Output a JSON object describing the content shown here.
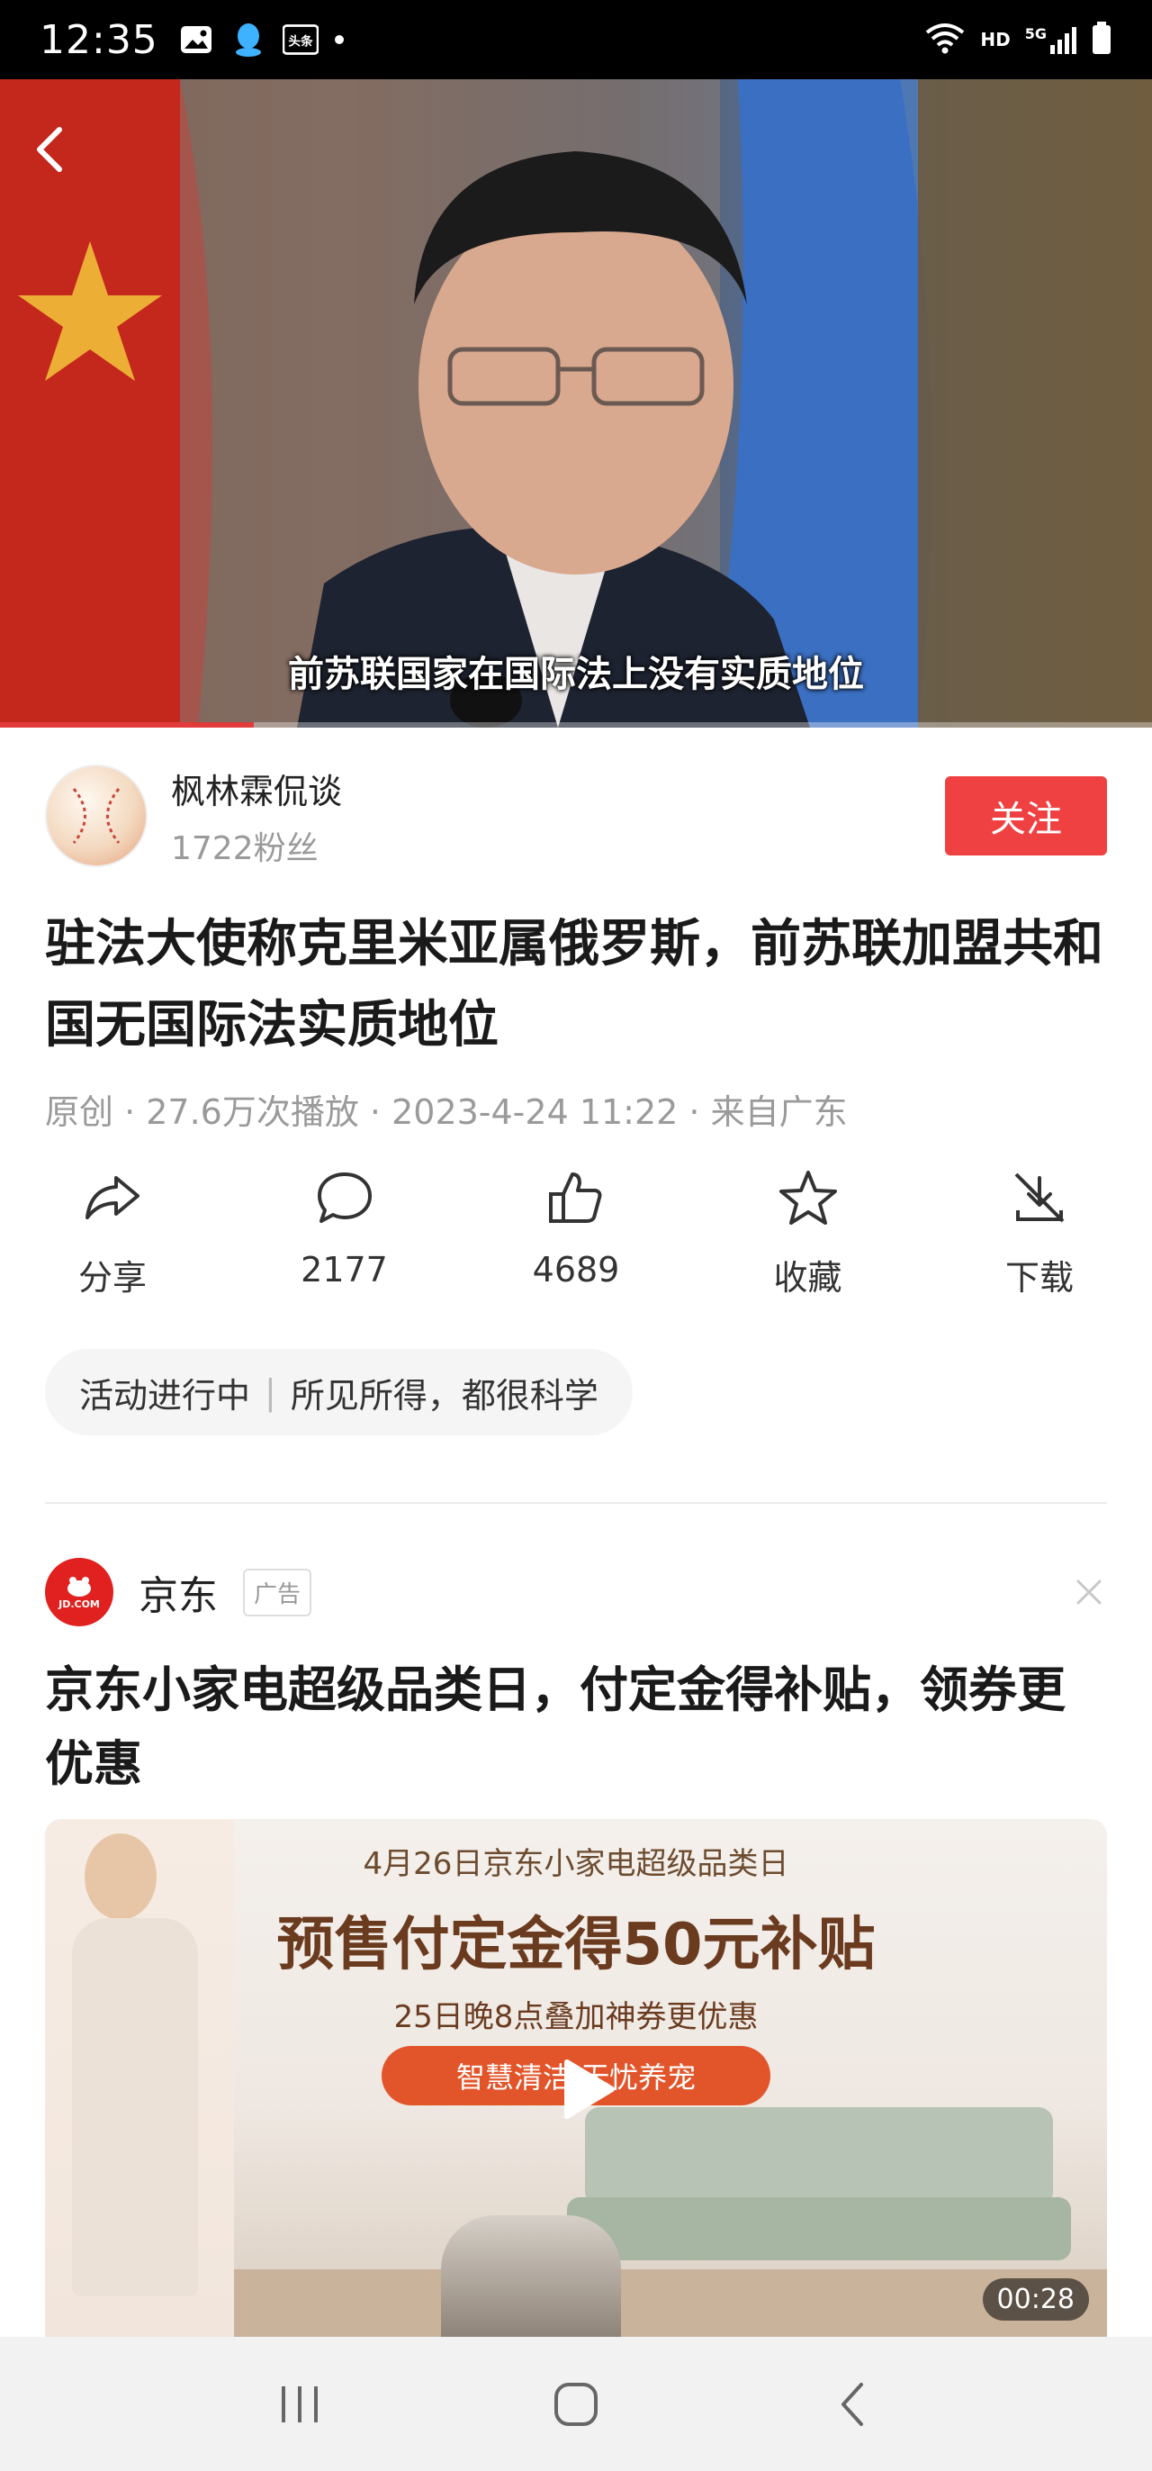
{
  "status_bar": {
    "time": "12:35",
    "left_icons": [
      "gallery-icon",
      "qq-icon",
      "toutiao-icon",
      "dot"
    ],
    "toutiao_label": "头条",
    "right_icons": [
      "wifi-icon",
      "hd-icon",
      "5g-signal-icon",
      "battery-icon"
    ],
    "hd_label": "HD",
    "network_label": "5G"
  },
  "video": {
    "subtitle": "前苏联国家在国际法上没有实质地位",
    "progress": 0.22
  },
  "author": {
    "name": "枫林霖侃谈",
    "fans": "1722粉丝",
    "follow_label": "关注"
  },
  "article": {
    "title": "驻法大使称克里米亚属俄罗斯，前苏联加盟共和国无国际法实质地位",
    "meta": "原创 · 27.6万次播放 · 2023-4-24 11:22 · 来自广东"
  },
  "actions": [
    {
      "icon": "share-icon",
      "label": "分享"
    },
    {
      "icon": "comment-icon",
      "label": "2177"
    },
    {
      "icon": "like-icon",
      "label": "4689"
    },
    {
      "icon": "star-icon",
      "label": "收藏"
    },
    {
      "icon": "download-icon",
      "label": "下载"
    }
  ],
  "activity": {
    "left": "活动进行中",
    "separator": "|",
    "right": "所见所得，都很科学"
  },
  "ad": {
    "brand": "京东",
    "logo_text": "JD.COM",
    "badge": "广告",
    "title": "京东小家电超级品类日，付定金得补贴，领券更优惠",
    "media": {
      "line1": "4月26日京东小家电超级品类日",
      "headline": "预售付定金得50元补贴",
      "line2": "25日晚8点叠加神券更优惠",
      "pill": "智慧清洁 无忧养宠",
      "duration": "00:28"
    }
  },
  "nav_bar": {
    "buttons": [
      "recents-icon",
      "home-icon",
      "back-icon"
    ]
  },
  "colors": {
    "accent_red": "#f04142",
    "jd_red": "#e0211f",
    "ad_orange": "#e2552a"
  }
}
